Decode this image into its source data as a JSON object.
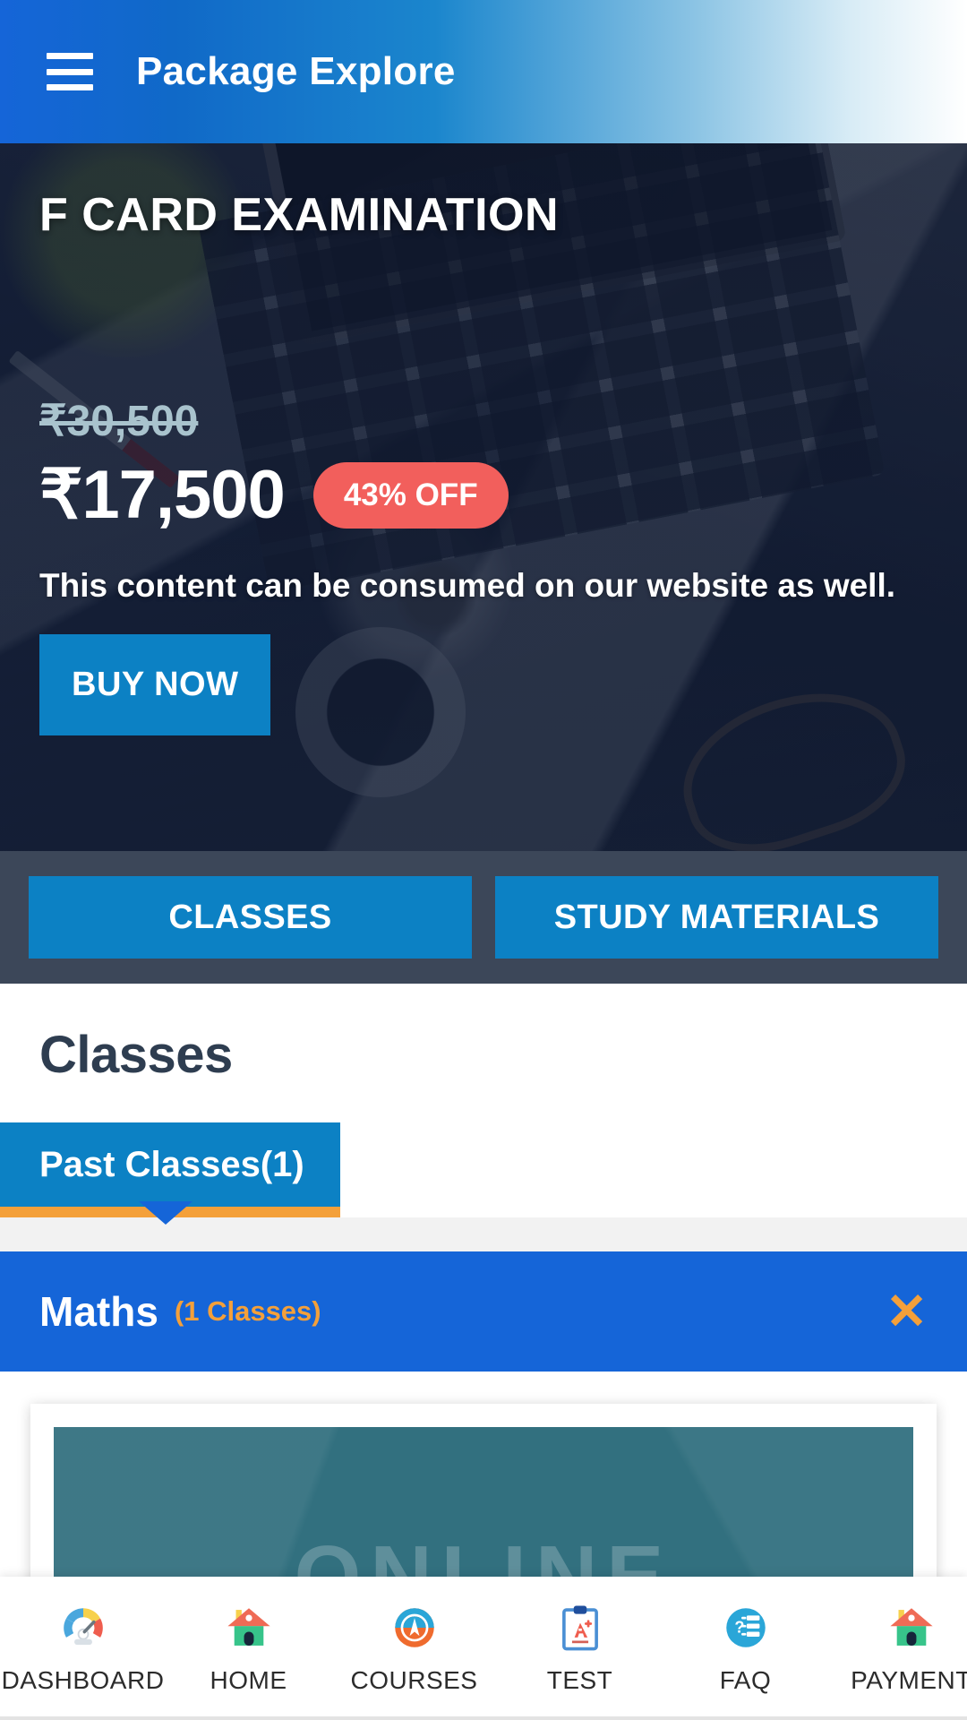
{
  "header": {
    "menu_icon": "hamburger-menu-icon",
    "title": "Package Explore"
  },
  "hero": {
    "title": "F CARD EXAMINATION",
    "price_old": "₹30,500",
    "price_new": "₹17,500",
    "discount_badge": "43% OFF",
    "description": "This content can be consumed on our website as well.",
    "buy_button": "BUY NOW",
    "overlay_color": "#101a30",
    "accent_blue": "#0c81c4",
    "discount_color": "#f25f5c",
    "old_price_color": "#a9c3cd"
  },
  "segments": [
    {
      "label": "CLASSES"
    },
    {
      "label": "STUDY MATERIALS"
    }
  ],
  "classes": {
    "section_title": "Classes",
    "tabs": [
      {
        "label": "Past Classes(1)",
        "active": true
      }
    ],
    "accordion": {
      "subject": "Maths",
      "count_label": "(1 Classes)",
      "close_icon": "close-x-icon",
      "bar_color": "#1565d8",
      "accent_color": "#f4a03a"
    },
    "card": {
      "thumbnail_text": "ONLINE",
      "thumbnail_color": "#32707f"
    }
  },
  "bottom_nav": [
    {
      "label": "DASHBOARD",
      "icon": "dashboard-gauge-icon"
    },
    {
      "label": "HOME",
      "icon": "home-house-icon"
    },
    {
      "label": "COURSES",
      "icon": "courses-compass-icon"
    },
    {
      "label": "TEST",
      "icon": "test-clipboard-icon"
    },
    {
      "label": "FAQ",
      "icon": "faq-question-list-icon"
    },
    {
      "label": "PAYMENT",
      "icon": "payment-house-icon"
    }
  ]
}
